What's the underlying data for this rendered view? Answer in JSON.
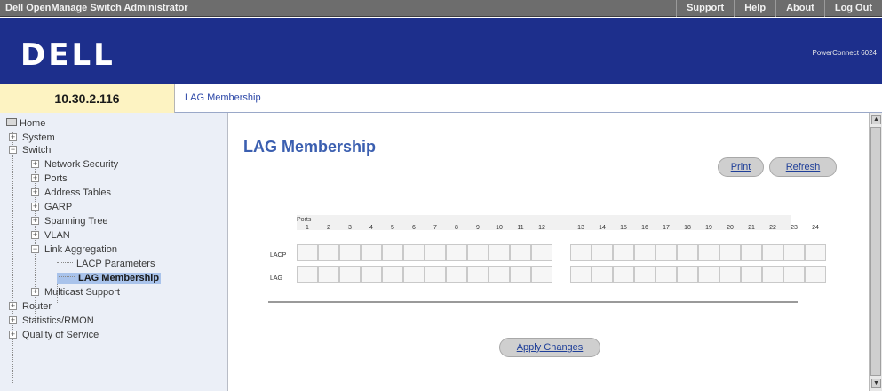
{
  "window": {
    "title": "Dell OpenManage Switch Administrator"
  },
  "top_links": [
    "Support",
    "Help",
    "About",
    "Log Out"
  ],
  "brand": {
    "logo": "DELL",
    "product": "PowerConnect 6024"
  },
  "address": {
    "ip": "10.30.2.116",
    "breadcrumb": "LAG Membership"
  },
  "nav": {
    "home": "Home",
    "items": [
      {
        "label": "System",
        "expander": "+"
      },
      {
        "label": "Switch",
        "expander": "−"
      },
      {
        "label": "Network Security",
        "expander": "+"
      },
      {
        "label": "Ports",
        "expander": "+"
      },
      {
        "label": "Address Tables",
        "expander": "+"
      },
      {
        "label": "GARP",
        "expander": "+"
      },
      {
        "label": "Spanning Tree",
        "expander": "+"
      },
      {
        "label": "VLAN",
        "expander": "+"
      },
      {
        "label": "Link Aggregation",
        "expander": "−"
      },
      {
        "label": "LACP Parameters",
        "expander": ""
      },
      {
        "label": "LAG Membership",
        "expander": "",
        "selected": true
      },
      {
        "label": "Multicast Support",
        "expander": "+"
      },
      {
        "label": "Router",
        "expander": "+"
      },
      {
        "label": "Statistics/RMON",
        "expander": "+"
      },
      {
        "label": "Quality of Service",
        "expander": "+"
      }
    ]
  },
  "main": {
    "title": "LAG Membership",
    "buttons": {
      "print": "Print",
      "refresh": "Refresh",
      "apply": "Apply Changes"
    },
    "grid": {
      "ports_label": "Ports",
      "row_labels": [
        "LACP",
        "LAG"
      ],
      "ports": [
        "1",
        "2",
        "3",
        "4",
        "5",
        "6",
        "7",
        "8",
        "9",
        "10",
        "11",
        "12",
        "13",
        "14",
        "15",
        "16",
        "17",
        "18",
        "19",
        "20",
        "21",
        "22",
        "23",
        "24"
      ]
    }
  },
  "colors": {
    "brand_blue": "#1d2f8c",
    "title_blue": "#3b5fb0",
    "nav_bg": "#ebeff7",
    "ip_bg": "#fdf3c2"
  }
}
